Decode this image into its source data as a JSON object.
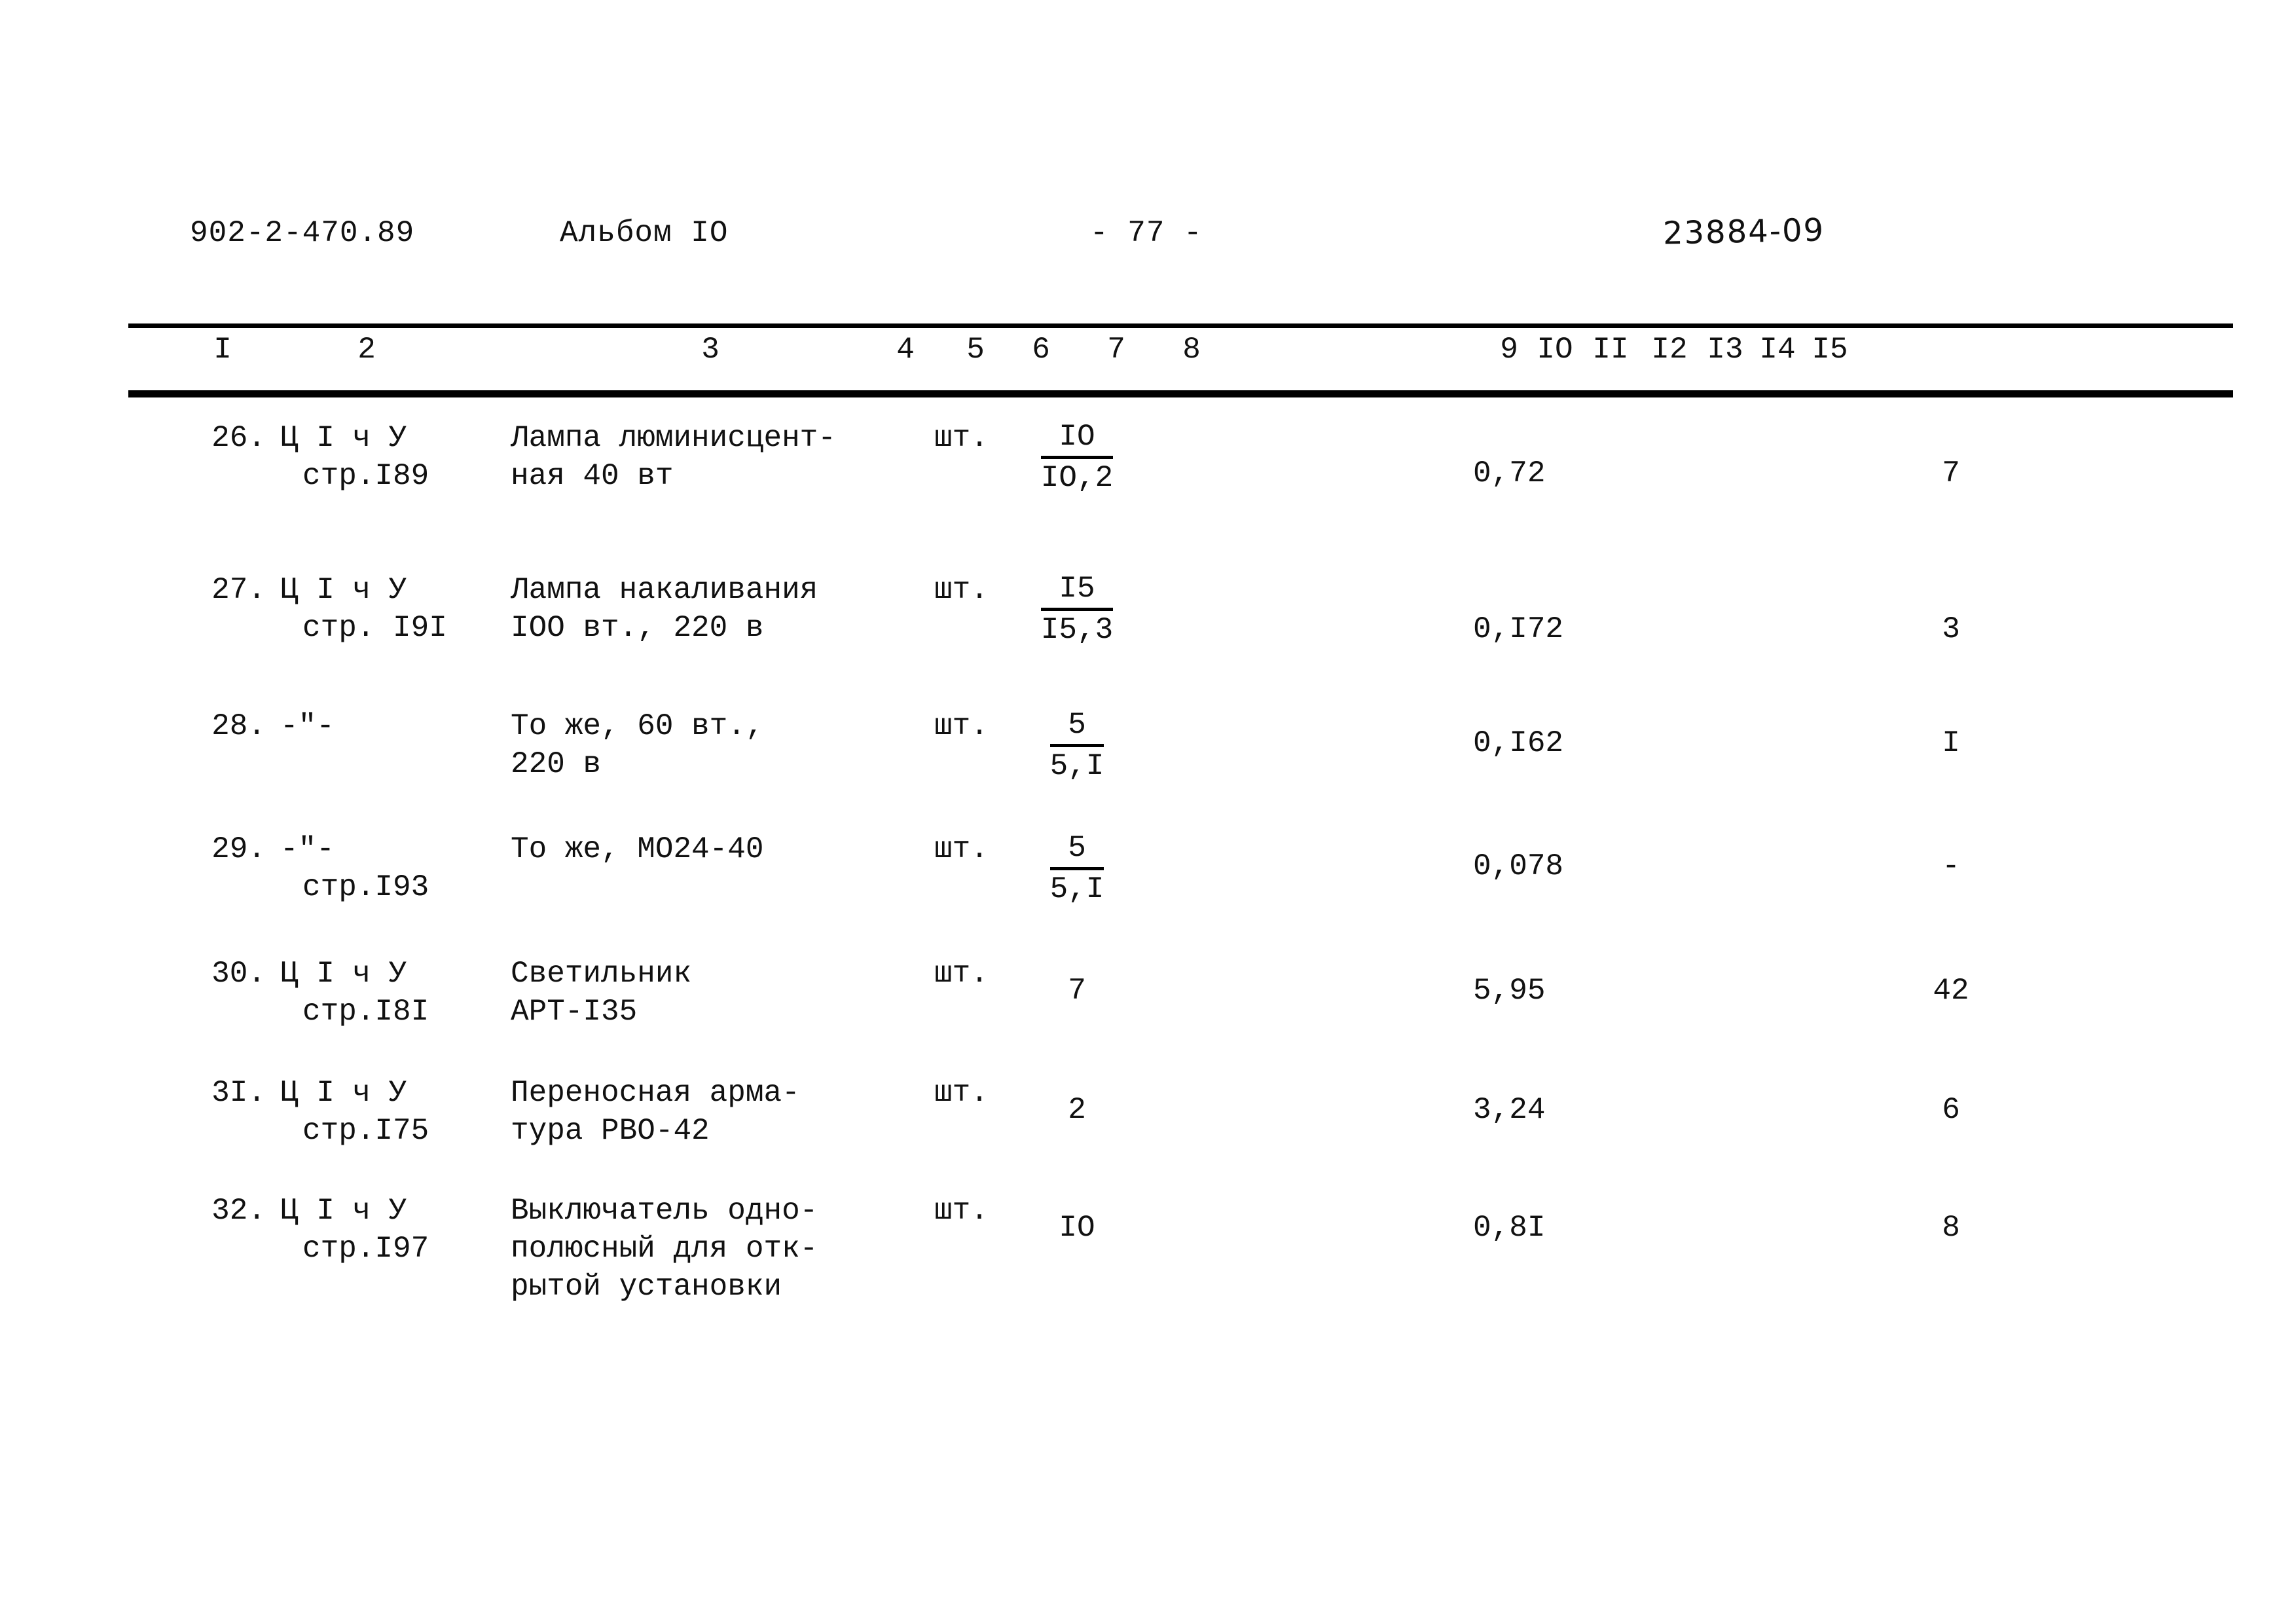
{
  "header": {
    "doc_code": "902-2-470.89",
    "album": "Альбом IO",
    "page_marker": "- 77 -",
    "stamp": "23884-09"
  },
  "table": {
    "column_numbers": [
      "I",
      "2",
      "3",
      "4",
      "5",
      "6",
      "7",
      "8",
      "9",
      "IO",
      "II",
      "I2",
      "I3",
      "I4",
      "I5"
    ],
    "rows": [
      {
        "num": "26.",
        "source_line1": "Ц I ч У",
        "source_line2": "стр.I89",
        "name_line1": "Лампа люминисцент-",
        "name_line2": "ная 40 вт",
        "name_line3": "",
        "unit": "шт.",
        "qty_numerator": "IO",
        "qty_denominator": "IO,2",
        "qty_plain": "",
        "price": "0,72",
        "total": "7"
      },
      {
        "num": "27.",
        "source_line1": "Ц I ч У",
        "source_line2": "стр. I9I",
        "name_line1": "Лампа накаливания",
        "name_line2": "IOO вт., 220 в",
        "name_line3": "",
        "unit": "шт.",
        "qty_numerator": "I5",
        "qty_denominator": "I5,3",
        "qty_plain": "",
        "price": "0,I72",
        "total": "3"
      },
      {
        "num": "28.",
        "source_line1": "-\"-",
        "source_line2": "",
        "name_line1": "То же, 60 вт.,",
        "name_line2": "220 в",
        "name_line3": "",
        "unit": "шт.",
        "qty_numerator": "5",
        "qty_denominator": "5,I",
        "qty_plain": "",
        "price": "0,I62",
        "total": "I"
      },
      {
        "num": "29.",
        "source_line1": "-\"-",
        "source_line2": "стр.I93",
        "name_line1": "То же, МО24-40",
        "name_line2": "",
        "name_line3": "",
        "unit": "шт.",
        "qty_numerator": "5",
        "qty_denominator": "5,I",
        "qty_plain": "",
        "price": "0,078",
        "total": "-"
      },
      {
        "num": "30.",
        "source_line1": "Ц I ч У",
        "source_line2": "стр.I8I",
        "name_line1": "Светильник",
        "name_line2": "АРТ-I35",
        "name_line3": "",
        "unit": "шт.",
        "qty_numerator": "",
        "qty_denominator": "",
        "qty_plain": "7",
        "price": "5,95",
        "total": "42"
      },
      {
        "num": "3I.",
        "source_line1": "Ц I ч У",
        "source_line2": "стр.I75",
        "name_line1": "Переносная арма-",
        "name_line2": "тура РВО-42",
        "name_line3": "",
        "unit": "шт.",
        "qty_numerator": "",
        "qty_denominator": "",
        "qty_plain": "2",
        "price": "3,24",
        "total": "6"
      },
      {
        "num": "32.",
        "source_line1": "Ц I ч У",
        "source_line2": "стр.I97",
        "name_line1": "Выключатель одно-",
        "name_line2": "полюсный для отк-",
        "name_line3": "рытой установки",
        "unit": "шт.",
        "qty_numerator": "",
        "qty_denominator": "",
        "qty_plain": "IO",
        "price": "0,8I",
        "total": "8"
      }
    ]
  }
}
